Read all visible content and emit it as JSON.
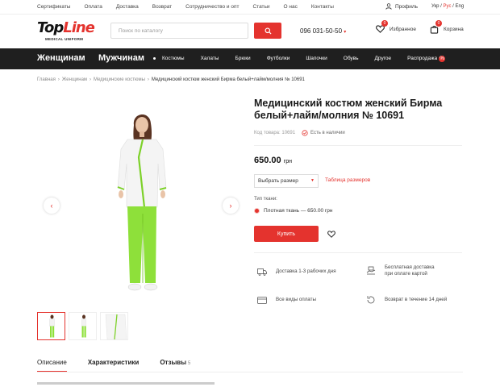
{
  "topbar": {
    "links": [
      "Сертификаты",
      "Оплата",
      "Доставка",
      "Возврат",
      "Сотрудничество и опт",
      "Статьи",
      "О нас",
      "Контакты"
    ],
    "profile": "Профиль",
    "lang": {
      "ua": "Укр",
      "ru": "Рус",
      "en": "Eng",
      "sep": " / "
    }
  },
  "header": {
    "logo_main": "Top",
    "logo_accent": "Line",
    "logo_sub": "MEDICAL UNIFORM",
    "search_placeholder": "Поиск по каталогу",
    "search_value": "",
    "phone": "096 031-50-50",
    "favorites_label": "Избранное",
    "favorites_count": "0",
    "cart_label": "Корзина",
    "cart_count": "0"
  },
  "nav": {
    "women": "Женщинам",
    "men": "Мужчинам",
    "items": [
      "Костюмы",
      "Халаты",
      "Брюки",
      "Футболки",
      "Шапочки",
      "Обувь",
      "Другое"
    ],
    "sale": "Распродажа",
    "sale_badge": "%"
  },
  "breadcrumb": [
    "Главная",
    "Женщинам",
    "Медицинские костюмы",
    "Медицинский костюм женский Бирма белый+лайм/молния № 10691"
  ],
  "product": {
    "title": "Медицинский костюм женский Бирма белый+лайм/молния № 10691",
    "code_label": "Код товара: 10691",
    "stock": "Есть в наличии",
    "price": "650.00",
    "currency": "грн",
    "size_select": "Выбрать размер",
    "size_table": "Таблица размеров",
    "fabric_label": "Тип ткани:",
    "fabric_option": "Плотная ткань — 650.00 грн",
    "buy": "Купить"
  },
  "features": [
    {
      "icon": "truck-icon",
      "text": "Доставка 1-3 рабочих дня"
    },
    {
      "icon": "free-delivery-icon",
      "line1": "Бесплатная доставка",
      "line2": "при оплате картой"
    },
    {
      "icon": "card-icon",
      "text": "Все виды оплаты"
    },
    {
      "icon": "return-icon",
      "text": "Возврат в течение 14 дней"
    }
  ],
  "tabs": {
    "description": "Описание",
    "specs": "Характеристики",
    "reviews": "Отзывы",
    "reviews_count": "5"
  },
  "colors": {
    "accent": "#e4332e",
    "nav_bg": "#1f1f1f",
    "lime": "#7dd12a"
  }
}
